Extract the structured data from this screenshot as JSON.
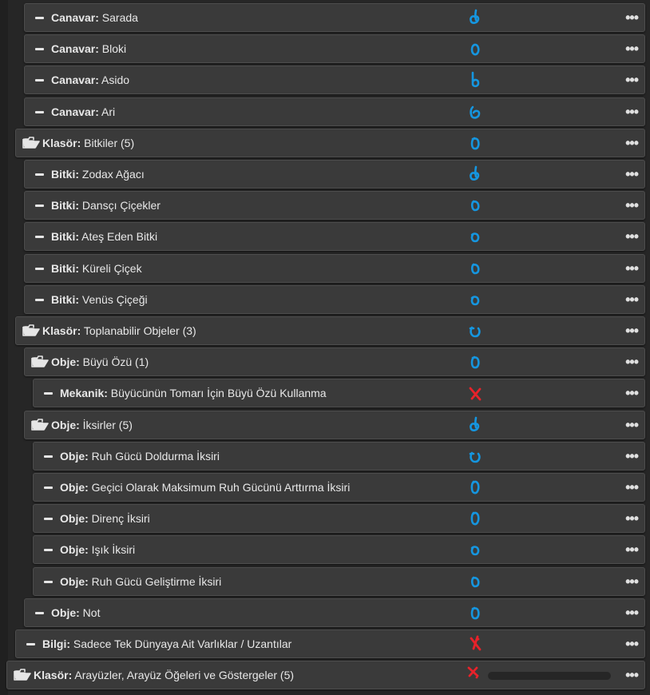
{
  "colors": {
    "blue_mark": "#1596e0",
    "red_mark": "#e8222a"
  },
  "rows": [
    {
      "indent": 30,
      "icon": "minus-icon",
      "label": "Canavar:",
      "value": "Sarada",
      "mark": "blue-d-1",
      "menu": "•••"
    },
    {
      "indent": 30,
      "icon": "minus-icon",
      "label": "Canavar:",
      "value": "Bloki",
      "mark": "blue-o-1",
      "menu": "•••"
    },
    {
      "indent": 30,
      "icon": "minus-icon",
      "label": "Canavar:",
      "value": "Asido",
      "mark": "blue-b",
      "menu": "•••"
    },
    {
      "indent": 30,
      "icon": "minus-icon",
      "label": "Canavar:",
      "value": "Ari",
      "mark": "blue-d-2",
      "menu": "•••"
    },
    {
      "indent": 19,
      "icon": "folder-open-icon",
      "label": "Klasör:",
      "value": "Bitkiler (5)",
      "mark": "blue-o-2",
      "menu": "•••"
    },
    {
      "indent": 30,
      "icon": "minus-icon",
      "label": "Bitki:",
      "value": "Zodax Ağacı",
      "mark": "blue-d-1",
      "menu": "•••"
    },
    {
      "indent": 30,
      "icon": "minus-icon",
      "label": "Bitki:",
      "value": "Dansçı Çiçekler",
      "mark": "blue-o-3",
      "menu": "•••"
    },
    {
      "indent": 30,
      "icon": "minus-icon",
      "label": "Bitki:",
      "value": "Ateş Eden Bitki",
      "mark": "blue-o-4",
      "menu": "•••"
    },
    {
      "indent": 30,
      "icon": "minus-icon",
      "label": "Bitki:",
      "value": "Küreli Çiçek",
      "mark": "blue-o-3",
      "menu": "•••"
    },
    {
      "indent": 30,
      "icon": "minus-icon",
      "label": "Bitki:",
      "value": "Venüs Çiçeği",
      "mark": "blue-o-4",
      "menu": "•••"
    },
    {
      "indent": 19,
      "icon": "folder-open-icon",
      "label": "Klasör:",
      "value": "Toplanabilir Objeler (3)",
      "mark": "blue-o-5",
      "menu": "•••"
    },
    {
      "indent": 30,
      "icon": "folder-open-icon",
      "label": "Obje:",
      "value": "Büyü Özü (1)",
      "mark": "blue-o-2",
      "menu": "•••"
    },
    {
      "indent": 41,
      "icon": "minus-icon",
      "label": "Mekanik:",
      "value": "Büyücünün Tomarı İçin Büyü Özü Kullanma",
      "mark": "red-x",
      "menu": "•••"
    },
    {
      "indent": 30,
      "icon": "folder-open-icon",
      "label": "Obje:",
      "value": "İksirler (5)",
      "mark": "blue-d-1",
      "menu": "•••"
    },
    {
      "indent": 41,
      "icon": "minus-icon",
      "label": "Obje:",
      "value": "Ruh Gücü Doldurma İksiri",
      "mark": "blue-o-5",
      "menu": "•••"
    },
    {
      "indent": 41,
      "icon": "minus-icon",
      "label": "Obje:",
      "value": "Geçici Olarak Maksimum Ruh Gücünü Arttırma İksiri",
      "mark": "blue-o-6",
      "menu": "•••"
    },
    {
      "indent": 41,
      "icon": "minus-icon",
      "label": "Obje:",
      "value": "Direnç İksiri",
      "mark": "blue-o-6",
      "menu": "•••"
    },
    {
      "indent": 41,
      "icon": "minus-icon",
      "label": "Obje:",
      "value": "Işık İksiri",
      "mark": "blue-o-4",
      "menu": "•••"
    },
    {
      "indent": 41,
      "icon": "minus-icon",
      "label": "Obje:",
      "value": "Ruh Gücü Geliştirme İksiri",
      "mark": "blue-o-3",
      "menu": "•••"
    },
    {
      "indent": 30,
      "icon": "minus-icon",
      "label": "Obje:",
      "value": "Not",
      "mark": "blue-o-2",
      "menu": "•••"
    },
    {
      "indent": 19,
      "icon": "minus-icon",
      "label": "Bilgi:",
      "value": "Sadece Tek Dünyaya Ait Varlıklar / Uzantılar",
      "mark": "red-x-2",
      "menu": "•••"
    },
    {
      "indent": 8,
      "icon": "folder-open-icon",
      "label": "Klasör:",
      "value": "Arayüzler, Arayüz Öğeleri ve Göstergeler (5)",
      "mark": "red-x-3",
      "menu": "•••",
      "bar": true
    }
  ]
}
